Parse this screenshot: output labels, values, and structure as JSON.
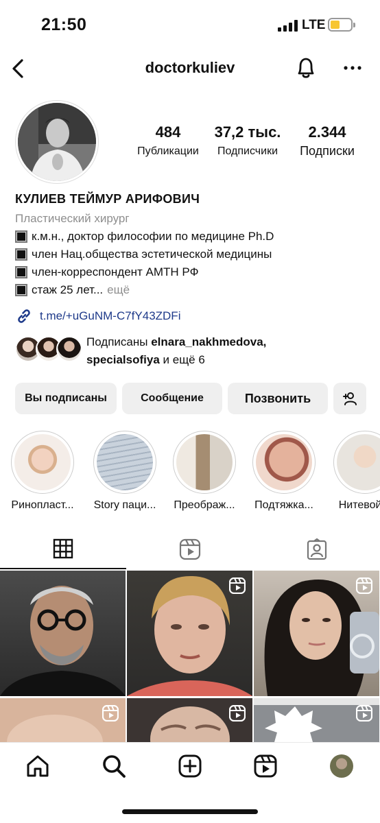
{
  "status": {
    "time": "21:50",
    "network": "LTE"
  },
  "header": {
    "handle": "doctorkuliev"
  },
  "icons": {
    "back": "back-chevron-icon",
    "notifications": "bell-icon",
    "more": "more-dots-icon",
    "link": "link-chain-icon",
    "add_person": "add-person-icon",
    "grid": "grid-icon",
    "reels": "reels-icon",
    "tagged": "tagged-person-icon",
    "reel_badge": "reel-badge-icon",
    "home": "home-icon",
    "search": "search-icon",
    "create": "create-plus-icon",
    "reels_nav": "reels-icon"
  },
  "profile": {
    "stats": [
      {
        "value": "484",
        "label": "Публикации"
      },
      {
        "value": "37,2 тыс.",
        "label": "Подписчики"
      },
      {
        "value": "2.344",
        "label": "Подписки"
      }
    ],
    "name": "КУЛИЕВ ТЕЙМУР АРИФОВИЧ",
    "category": "Пластический хирург",
    "bio_lines": [
      "к.м.н., доктор философии по медицине Ph.D",
      "член Нац.общества эстетической медицины",
      "член-корреспондент АМТН РФ",
      "стаж 25 лет..."
    ],
    "more_label": "ещё",
    "link": "t.me/+uGuNM-C7fY43ZDFi",
    "followed_by": {
      "prefix": "Подписаны",
      "user1": "elnara_nakhmedova,",
      "user2": "specialsofiya",
      "suffix": "и ещё 6"
    }
  },
  "actions": {
    "following": "Вы подписаны",
    "message": "Сообщение",
    "call": "Позвонить"
  },
  "highlights": [
    "Ринопласт...",
    "Story паци...",
    "Преображ...",
    "Подтяжка...",
    "Нитевой л"
  ],
  "colors": {
    "link": "#1e3a8a",
    "button_bg": "#efefef",
    "battery": "#f7c631",
    "muted": "#8e8e8e"
  }
}
